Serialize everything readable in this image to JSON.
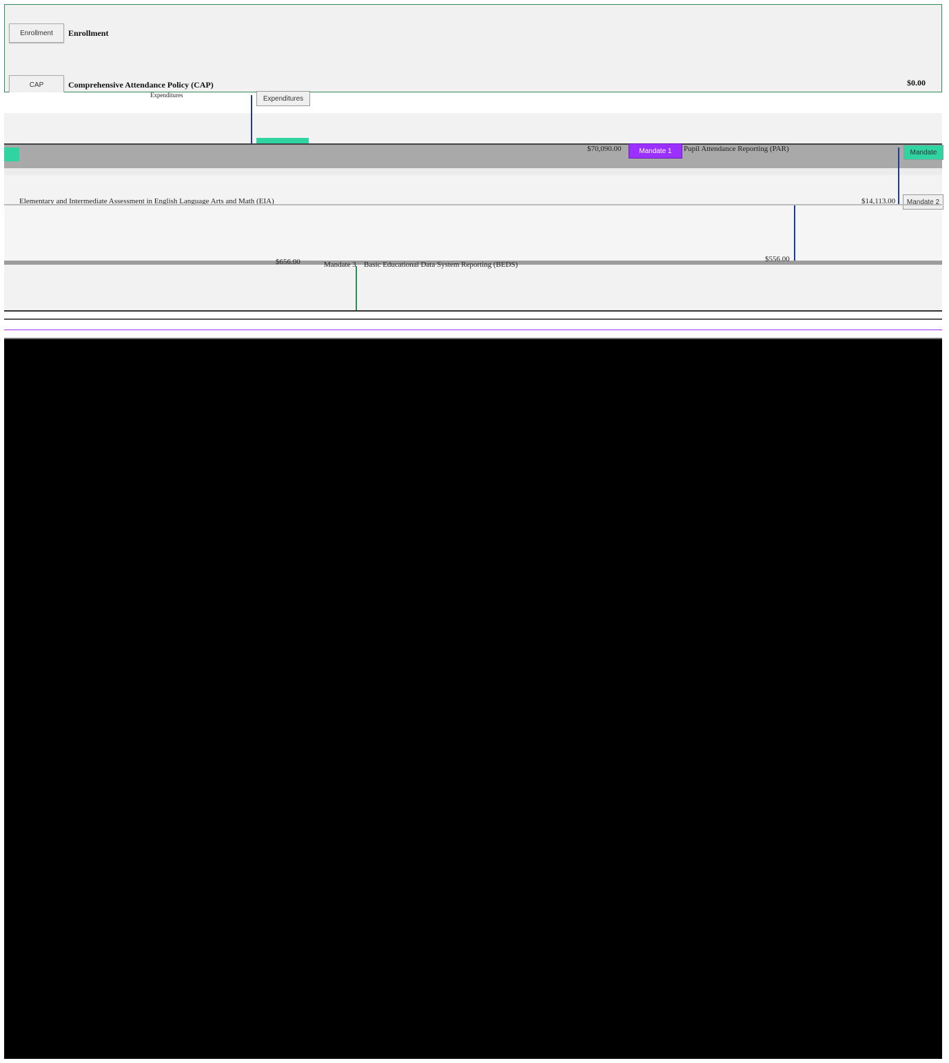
{
  "rows": [
    {
      "button": "Enrollment",
      "title": "Enrollment",
      "amount": ""
    },
    {
      "button": "CAP",
      "title": "Comprehensive Attendance Policy (CAP)",
      "amount": "$0.00"
    }
  ],
  "fragments": {
    "expenditures_button": "Expenditures",
    "expenditures_label": "Expenditures",
    "amount_1": "$70,090.00",
    "mandate_1": "Mandate 1",
    "par_title": "Pupil Attendance Reporting (PAR)",
    "mandate_right": "Mandate",
    "ela_title": "Elementary and Intermediate Assessment in English Language Arts and Math (EIA)",
    "amount_2": "$14,113.00",
    "mandate_2": "Mandate 2",
    "amount_3": "$656.00",
    "amount_4": "$556.00",
    "mandate_3": "Mandate 3",
    "beds_title": "Basic Educational Data System Reporting (BEDS)"
  },
  "colors": {
    "border_green": "#2e8b57",
    "purple": "#9b30ff",
    "teal": "#2fd4a0",
    "navy": "#1f3a93"
  }
}
